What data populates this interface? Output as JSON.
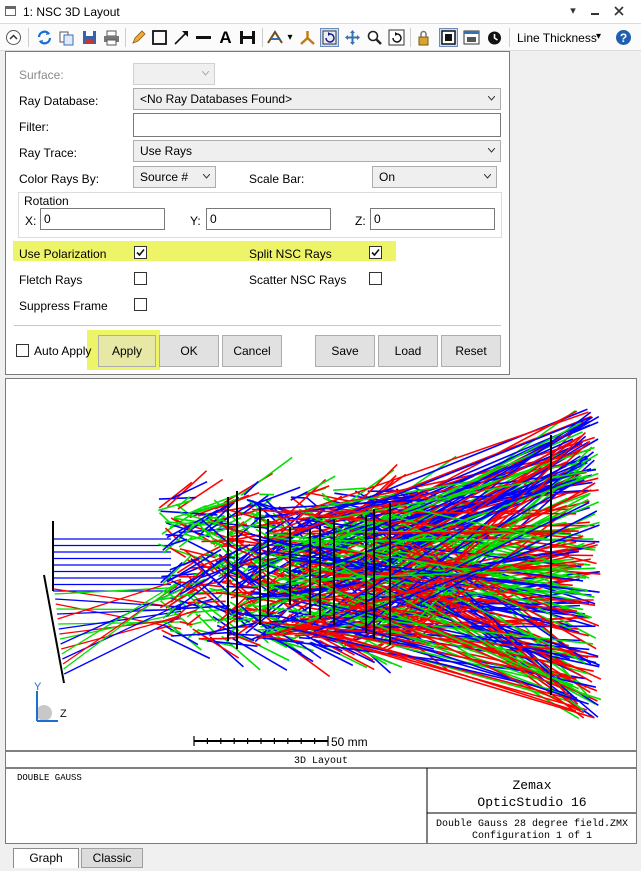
{
  "window": {
    "title": "1: NSC 3D Layout"
  },
  "toolbar": {
    "line_thickness_label": "Line Thickness"
  },
  "settings": {
    "surface": {
      "label": "Surface:",
      "value": ""
    },
    "ray_database": {
      "label": "Ray Database:",
      "value": "<No Ray Databases Found>"
    },
    "filter": {
      "label": "Filter:",
      "value": ""
    },
    "ray_trace": {
      "label": "Ray Trace:",
      "value": "Use Rays"
    },
    "color_rays_by": {
      "label": "Color Rays By:",
      "value": "Source #"
    },
    "scale_bar": {
      "label": "Scale Bar:",
      "value": "On"
    },
    "rotation": {
      "label": "Rotation",
      "x_label": "X:",
      "x_value": "0",
      "y_label": "Y:",
      "y_value": "0",
      "z_label": "Z:",
      "z_value": "0"
    },
    "use_polarization": {
      "label": "Use Polarization",
      "checked": true
    },
    "split_nsc_rays": {
      "label": "Split NSC Rays",
      "checked": true
    },
    "fletch_rays": {
      "label": "Fletch Rays",
      "checked": false
    },
    "scatter_nsc_rays": {
      "label": "Scatter NSC Rays",
      "checked": false
    },
    "suppress_frame": {
      "label": "Suppress Frame",
      "checked": false
    },
    "auto_apply": {
      "label": "Auto Apply",
      "checked": false
    },
    "buttons": {
      "apply": "Apply",
      "ok": "OK",
      "cancel": "Cancel",
      "save": "Save",
      "load": "Load",
      "reset": "Reset"
    },
    "highlight_color": "#eef467"
  },
  "plot": {
    "scale_bar_label": "50 mm",
    "axis_y": "Y",
    "axis_z": "Z",
    "caption": "3D Layout",
    "ray_colors": [
      "#ff0000",
      "#00e000",
      "#0000ff"
    ]
  },
  "info_block": {
    "lens_title": "DOUBLE GAUSS",
    "company": "Zemax",
    "product": "OpticStudio 16",
    "file_name": "Double Gauss 28 degree field.ZMX",
    "configuration": "Configuration 1 of 1"
  },
  "tabs": [
    {
      "label": "Graph",
      "active": true
    },
    {
      "label": "Classic",
      "active": false
    }
  ]
}
